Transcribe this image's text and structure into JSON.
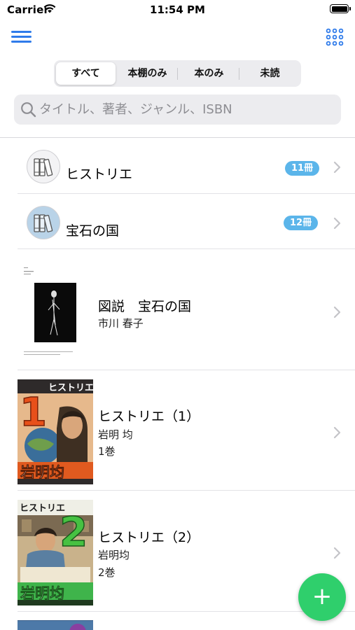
{
  "status_bar": {
    "carrier": "Carrier",
    "time": "11:54 PM"
  },
  "nav": {
    "menu_icon": "hamburger-menu-icon",
    "grid_icon": "grid-dots-icon"
  },
  "segments": [
    {
      "label": "すべて",
      "selected": true
    },
    {
      "label": "本棚のみ",
      "selected": false
    },
    {
      "label": "本のみ",
      "selected": false
    },
    {
      "label": "未読",
      "selected": false
    }
  ],
  "search": {
    "placeholder": "タイトル、著者、ジャンル、ISBN",
    "value": ""
  },
  "shelves": [
    {
      "title": "ヒストリエ",
      "count": "11冊",
      "icon": "bookshelf-icon"
    },
    {
      "title": "宝石の国",
      "count": "12冊",
      "icon": "bookshelf-icon"
    }
  ],
  "books": [
    {
      "title": "図説　宝石の国",
      "author": "市川 春子",
      "volume": ""
    },
    {
      "title": "ヒストリエ（1）",
      "author": "岩明 均",
      "volume": "1巻",
      "cover_number": "1",
      "cover_logo": "ヒストリエ",
      "cover_author": "岩明均"
    },
    {
      "title": "ヒストリエ（2）",
      "author": "岩明均",
      "volume": "2巻",
      "cover_number": "2",
      "cover_logo": "ヒストリエ",
      "cover_author": "岩明均"
    }
  ],
  "fab": {
    "label": "+"
  },
  "colors": {
    "accent": "#2f7bea",
    "badge": "#5bb5ea",
    "fab": "#2fcf6c",
    "cover_orange": "#e05a1f",
    "cover_green": "#3fb44b"
  }
}
